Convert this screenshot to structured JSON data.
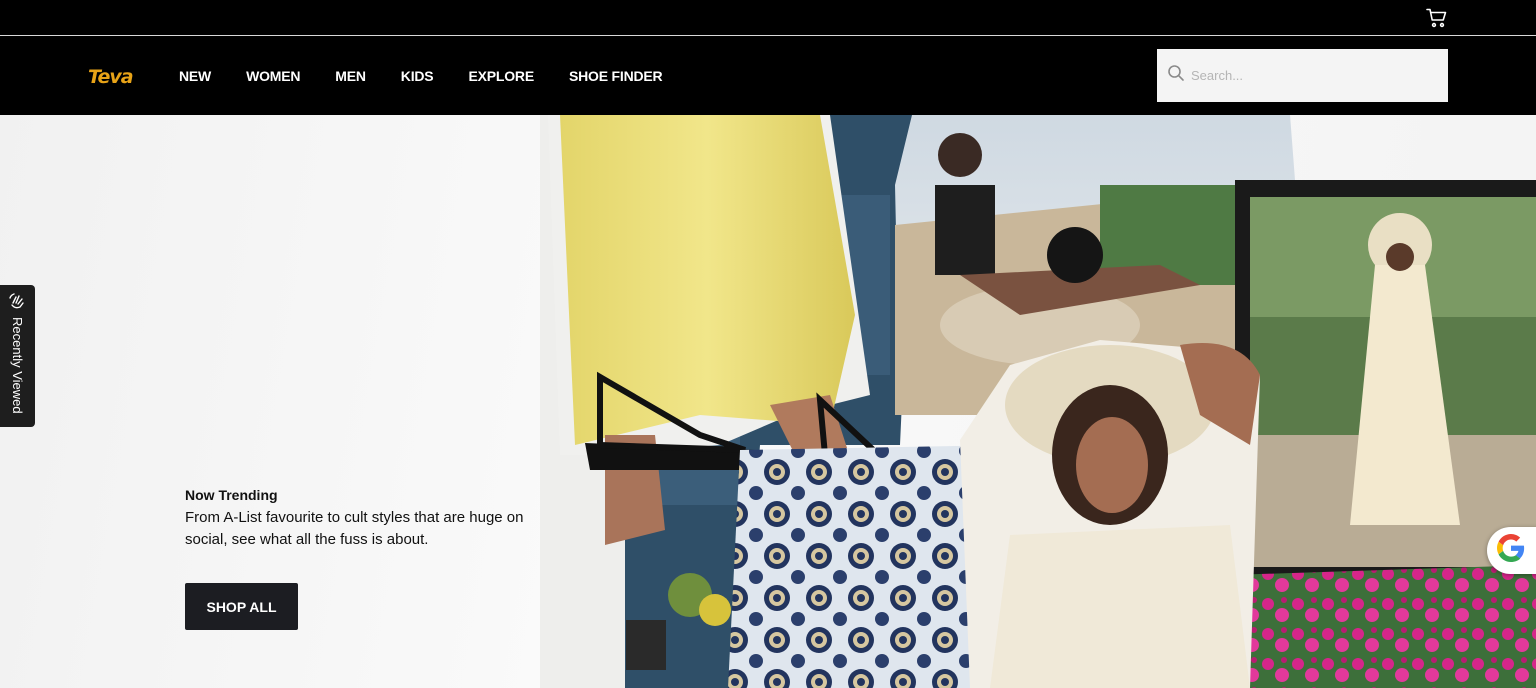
{
  "header": {
    "logo_text": "Teva",
    "cart_icon": "shopping-cart-icon"
  },
  "nav": {
    "items": [
      {
        "label": "NEW"
      },
      {
        "label": "WOMEN"
      },
      {
        "label": "MEN"
      },
      {
        "label": "KIDS"
      },
      {
        "label": "EXPLORE"
      },
      {
        "label": "SHOE FINDER"
      }
    ]
  },
  "search": {
    "placeholder": "Search...",
    "value": "",
    "icon": "search-icon"
  },
  "sidebar_tab": {
    "label": "Recently Viewed",
    "icon": "hand-wave-icon"
  },
  "hero": {
    "heading": "Now Trending",
    "body": "From A-List favourite to cult styles that are huge on social, see what all the fuss is about.",
    "cta_label": "SHOP ALL"
  },
  "widget": {
    "icon": "google-g-icon"
  },
  "colors": {
    "brand_gold": "#e8a317",
    "header_bg": "#000000",
    "button_bg": "#1c1d22"
  }
}
